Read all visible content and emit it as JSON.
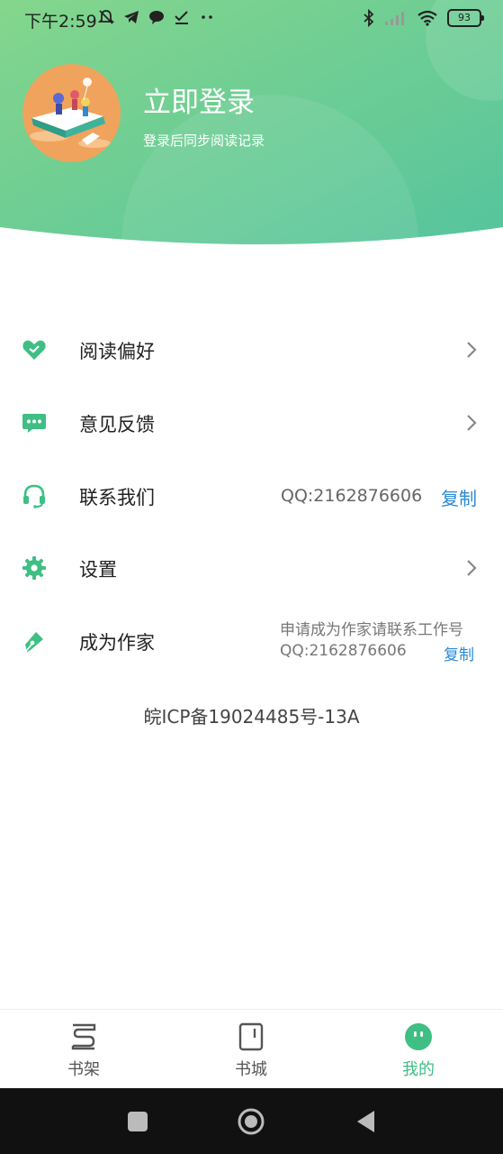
{
  "status_bar": {
    "time": "下午2:59",
    "battery": "93",
    "left_icons": [
      "mute-icon",
      "telegram-icon",
      "chat-icon",
      "check-icon",
      "more-dots-icon"
    ],
    "right_icons": [
      "bluetooth-icon",
      "signal-icon",
      "wifi-icon",
      "battery-icon"
    ]
  },
  "header": {
    "login_title": "立即登录",
    "login_subtitle": "登录后同步阅读记录",
    "gradient_start": "#7ed38e",
    "gradient_end": "#5cc79b"
  },
  "menu": {
    "items": [
      {
        "label": "阅读偏好",
        "icon": "heart-icon",
        "action": "chevron-right-icon"
      },
      {
        "label": "意见反馈",
        "icon": "chat-bubble-icon",
        "action": "chevron-right-icon"
      },
      {
        "label": "联系我们",
        "icon": "headset-icon",
        "qq": "QQ:2162876606",
        "copy": "复制"
      },
      {
        "label": "设置",
        "icon": "gear-icon",
        "action": "chevron-right-icon"
      },
      {
        "label": "成为作家",
        "icon": "pen-icon",
        "note": "申请成为作家请联系工作号",
        "qq": "QQ:2162876606",
        "copy": "复制"
      }
    ]
  },
  "icp": "皖ICP备19024485号-13A",
  "tabbar": {
    "tabs": [
      {
        "label": "书架",
        "icon": "bookshelf-icon",
        "active": false
      },
      {
        "label": "书城",
        "icon": "bookstore-icon",
        "active": false
      },
      {
        "label": "我的",
        "icon": "profile-face-icon",
        "active": true
      }
    ]
  },
  "colors": {
    "accent": "#3fbf83",
    "link": "#2a8ad6",
    "nav_bar": "#111111"
  }
}
